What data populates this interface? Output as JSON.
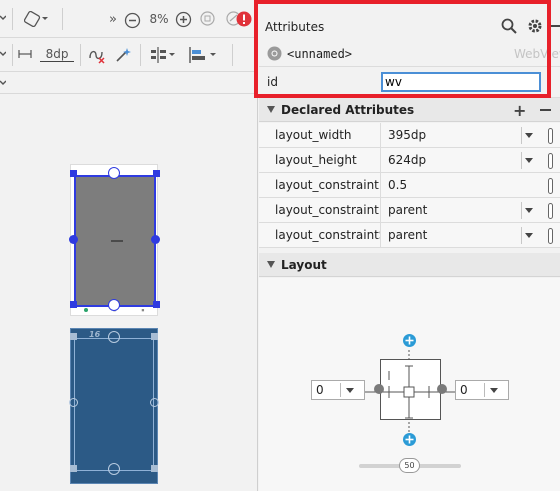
{
  "toolbar": {
    "chevrons": "»",
    "zoom": "8%",
    "margin": "8dp"
  },
  "attributes": {
    "title": "Attributes",
    "component_name": "<unnamed>",
    "component_type": "WebView",
    "id_label": "id",
    "id_value": "wv"
  },
  "declared": {
    "title": "Declared Attributes",
    "rows": [
      {
        "name": "layout_width",
        "value": "395dp"
      },
      {
        "name": "layout_height",
        "value": "624dp"
      },
      {
        "name": "layout_constraintHorizontal_bias",
        "value": "0.5"
      },
      {
        "name": "layout_constraintEnd_toEndOf",
        "value": "parent"
      },
      {
        "name": "layout_constraintStart_toStartOf",
        "value": "parent"
      }
    ]
  },
  "layout": {
    "title": "Layout",
    "left_margin": "0",
    "right_margin": "0",
    "bias": "50"
  },
  "preview": {
    "blueprint_label": "16"
  },
  "colors": {
    "accent_blue": "#2f3be0",
    "highlight_red": "#e8202a",
    "layout_plus": "#2b9bd6"
  }
}
